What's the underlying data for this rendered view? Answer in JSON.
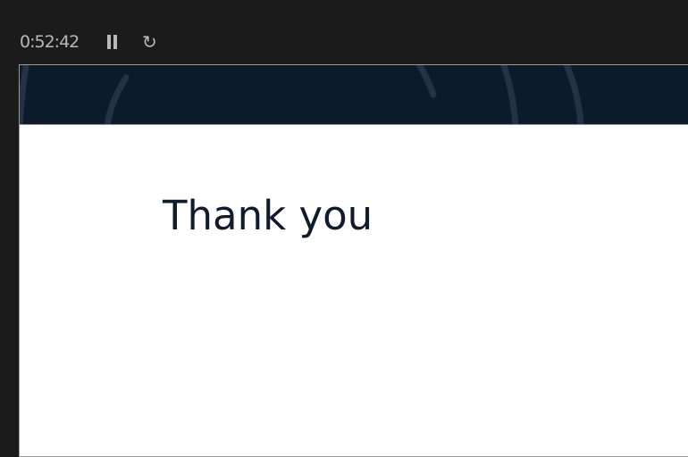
{
  "toolbar": {
    "timer": "0:52:42",
    "pause_icon": "pause-icon",
    "restart_icon": "restart-icon",
    "restart_glyph": "↻"
  },
  "slide": {
    "title": "Thank you",
    "banner_color": "#0c1a2b"
  }
}
